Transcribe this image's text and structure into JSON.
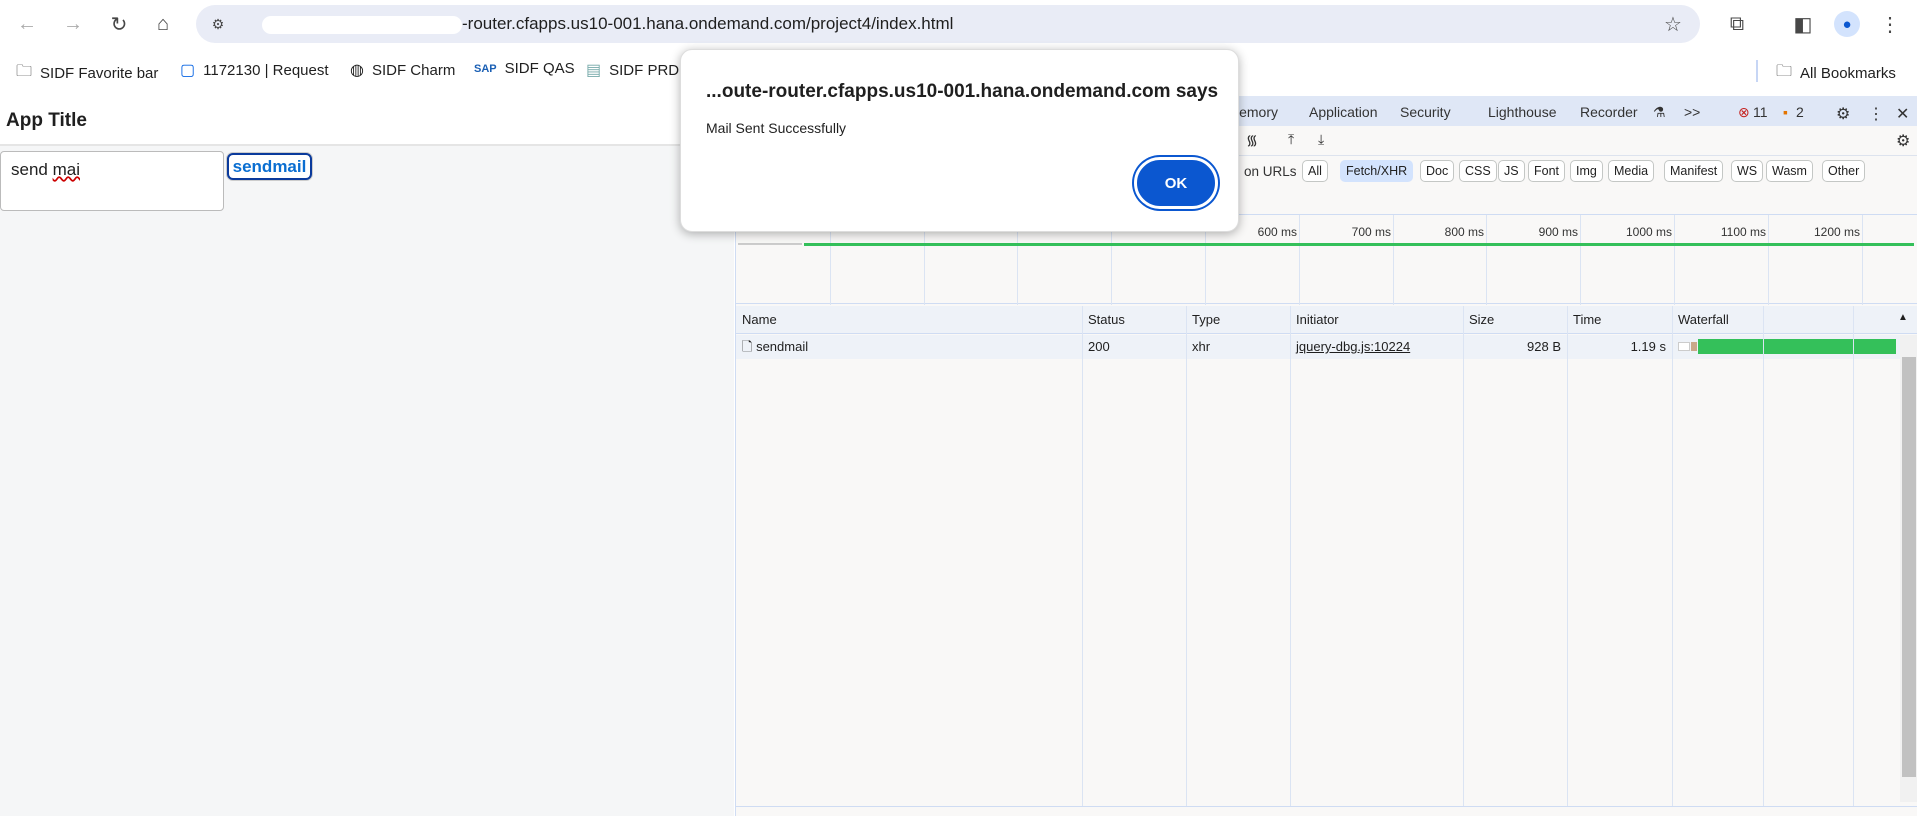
{
  "browser": {
    "url_visible": "-router.cfapps.us10-001.hana.ondemand.com/project4/index.html",
    "bookmarks": [
      "SIDF Favorite bar",
      "1172130 | Request",
      "SIDF Charm",
      "SIDF QAS",
      "SIDF PRD"
    ],
    "all_bookmarks": "All Bookmarks"
  },
  "app": {
    "title": "App Title",
    "input_value_a": "send ",
    "input_value_b": "mai",
    "button": "sendmail"
  },
  "dialog": {
    "title": "...oute-router.cfapps.us10-001.hana.ondemand.com says",
    "message": "Mail Sent Successfully",
    "ok": "OK"
  },
  "devtools": {
    "tabs": [
      "lemory",
      "Application",
      "Security",
      "Lighthouse",
      "Recorder"
    ],
    "more": ">>",
    "errors": "11",
    "warnings": "2",
    "filter_label": "on URLs",
    "filters": [
      "All",
      "Fetch/XHR",
      "Doc",
      "CSS",
      "JS",
      "Font",
      "Img",
      "Media",
      "Manifest",
      "WS",
      "Wasm",
      "Other"
    ],
    "ticks": [
      "600 ms",
      "700 ms",
      "800 ms",
      "900 ms",
      "1000 ms",
      "1100 ms",
      "1200 ms"
    ],
    "columns": [
      "Name",
      "Status",
      "Type",
      "Initiator",
      "Size",
      "Time",
      "Waterfall"
    ],
    "rows": [
      {
        "name": "sendmail",
        "status": "200",
        "type": "xhr",
        "initiator": "jquery-dbg.js:10224",
        "size": "928 B",
        "time": "1.19 s"
      }
    ]
  },
  "colors": {
    "accent": "#0b57d0",
    "green": "#34c05a"
  }
}
